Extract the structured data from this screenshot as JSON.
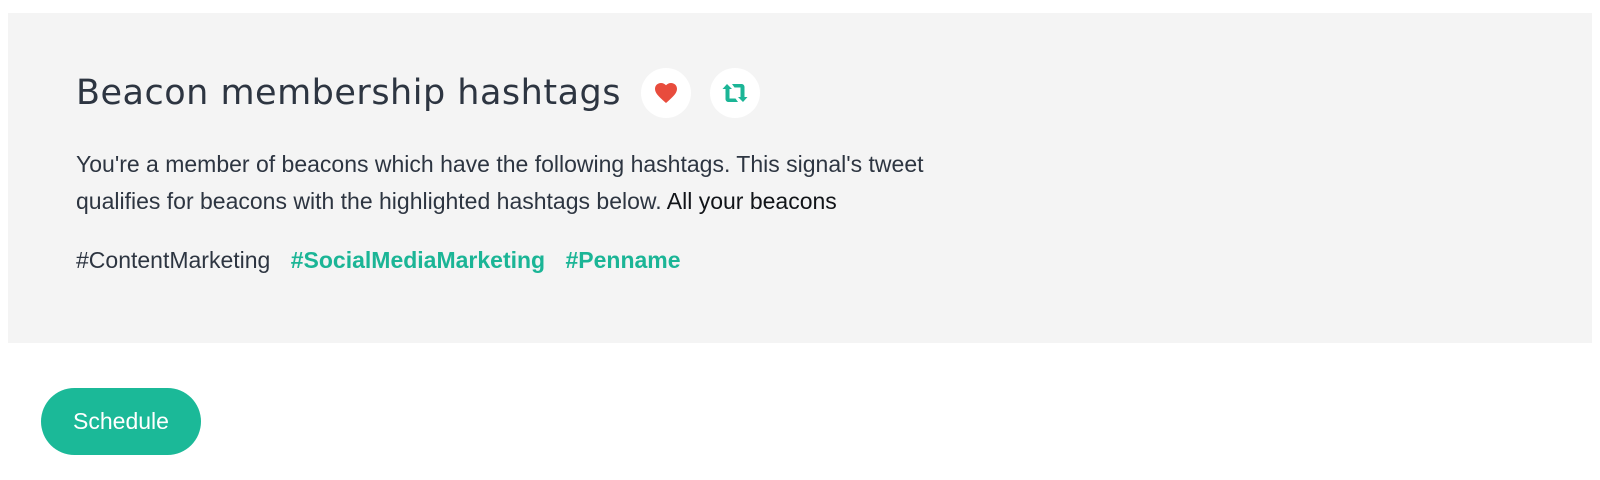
{
  "section": {
    "title": "Beacon membership hashtags",
    "description": "You're a member of beacons which have the following hashtags. This signal's tweet qualifies for beacons with the highlighted hashtags below.",
    "all_beacons_link": "All your beacons",
    "hashtags": [
      {
        "text": "#ContentMarketing",
        "highlighted": false
      },
      {
        "text": "#SocialMediaMarketing",
        "highlighted": true
      },
      {
        "text": "#Penname",
        "highlighted": true
      }
    ],
    "icons": {
      "like": "heart-icon",
      "retweet": "retweet-icon"
    }
  },
  "actions": {
    "schedule_label": "Schedule"
  },
  "colors": {
    "panel_bg": "#f4f4f4",
    "accent": "#1bb998",
    "heart": "#e84c3d",
    "text": "#2d3541"
  }
}
